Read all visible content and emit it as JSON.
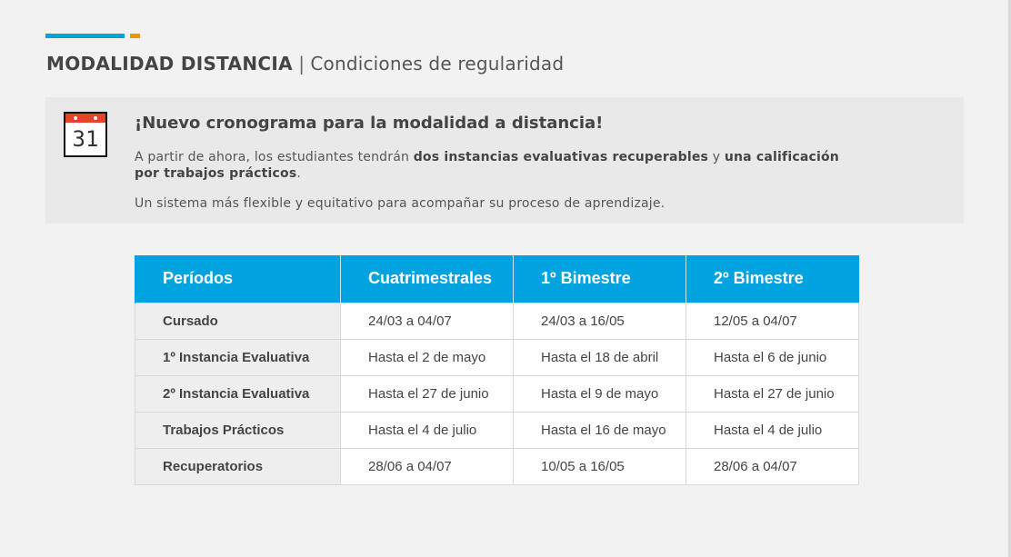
{
  "colors": {
    "accent_blue": "#00a3e0",
    "accent_orange": "#f39200",
    "calendar_red": "#e8412c",
    "notice_bg": "#e9e9e9",
    "page_bg": "#f2f2f2"
  },
  "header": {
    "title_bold": "MODALIDAD DISTANCIA",
    "separator": "|",
    "subtitle": "Condiciones de regularidad"
  },
  "notice": {
    "icon": "calendar-icon",
    "calendar_number": "31",
    "title": "¡Nuevo cronograma para la modalidad a distancia!",
    "p1_part1": "A partir de ahora, los estudiantes tendrán ",
    "p1_bold1": "dos instancias evaluativas recuperables",
    "p1_part2": " y ",
    "p1_bold2": "una calificación por trabajos prácticos",
    "p1_part3": ".",
    "p2": "Un sistema más flexible y equitativo para acompañar su proceso de aprendizaje."
  },
  "table": {
    "headers": [
      "Períodos",
      "Cuatrimestrales",
      "1º Bimestre",
      "2º Bimestre"
    ],
    "rows": [
      {
        "label": "Cursado",
        "cells": [
          "24/03 a 04/07",
          "24/03 a 16/05",
          "12/05 a 04/07"
        ]
      },
      {
        "label": "1º Instancia Evaluativa",
        "cells": [
          "Hasta el 2 de mayo",
          "Hasta el 18 de abril",
          "Hasta el 6 de junio"
        ]
      },
      {
        "label": "2º Instancia Evaluativa",
        "cells": [
          "Hasta el 27 de junio",
          "Hasta el 9 de mayo",
          "Hasta el 27 de junio"
        ]
      },
      {
        "label": "Trabajos Prácticos",
        "cells": [
          "Hasta el 4 de julio",
          "Hasta el 16 de mayo",
          "Hasta el 4 de julio"
        ]
      },
      {
        "label": "Recuperatorios",
        "cells": [
          "28/06 a 04/07",
          "10/05 a 16/05",
          "28/06 a 04/07"
        ]
      }
    ]
  }
}
